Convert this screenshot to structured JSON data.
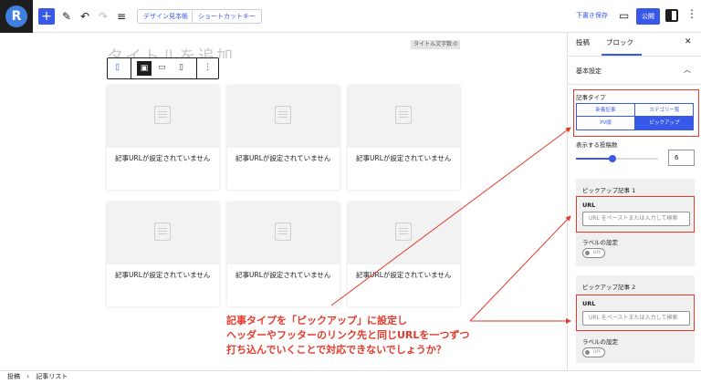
{
  "topbar": {
    "logo_letter": "R",
    "add_icon": "plus-icon",
    "design_book_label": "デザイン見本帳",
    "shortcut_label": "ショートカットキー",
    "save_draft_label": "下書き保存",
    "publish_label": "公開",
    "accent_color": "#3858e9"
  },
  "canvas": {
    "title_count_badge": "タイトル文字数:0",
    "ghost_title": "タイトルを追加",
    "card_placeholder_text": "記事URLが設定されていません",
    "card_count": 6
  },
  "annotation": {
    "line1": "記事タイプを「ピックアップ」に設定し",
    "line2": "ヘッダーやフッターのリンク先と同じURLを一つずつ",
    "line3": "打ち込んでいくことで対応できないでしょうか？",
    "color": "#e33b2c"
  },
  "sidebar": {
    "tab_post": "投稿",
    "tab_block": "ブロック",
    "panel_title": "基本設定",
    "article_type_label": "記事タイプ",
    "types": [
      "新着記事",
      "カテゴリー覧",
      "PV順",
      "ピックアップ"
    ],
    "selected_type": "ピックアップ",
    "display_count_label": "表示する投稿数",
    "display_count": "6",
    "pickup_1_title": "ピックアップ記事 1",
    "pickup_2_title": "ピックアップ記事 2",
    "url_label": "URL",
    "url_placeholder": "URL をペーストまたは入力して検索",
    "label_setting": "ラベルの設定",
    "toggle_off": "OFF"
  },
  "statusbar": {
    "crumb1": "投稿",
    "sep": "›",
    "crumb2": "記事リスト"
  }
}
